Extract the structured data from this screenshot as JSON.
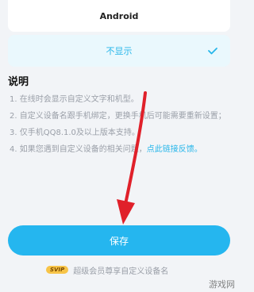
{
  "options": [
    {
      "label": "Android"
    },
    {
      "label": "不显示",
      "selected": true
    }
  ],
  "section_title": "说明",
  "notes": [
    {
      "text": "1. 在线时会显示自定义文字和机型。"
    },
    {
      "text": "2. 自定义设备名跟手机绑定，更换手机后可能需要重新设置；"
    },
    {
      "text": "3. 仅手机QQ8.1.0及以上版本支持。"
    },
    {
      "text": "4. 如果您遇到自定义设备的相关问题，",
      "link": "点此链接反馈。"
    }
  ],
  "save_button": "保存",
  "vip_badge": "SVIP",
  "vip_text": "超级会员尊享自定义设备名",
  "watermark": "游戏网",
  "colors": {
    "accent": "#25b6ef",
    "arrow": "#e0202a"
  },
  "icons": {
    "check": "checkmark-icon",
    "arrow": "red-arrow-annotation"
  }
}
